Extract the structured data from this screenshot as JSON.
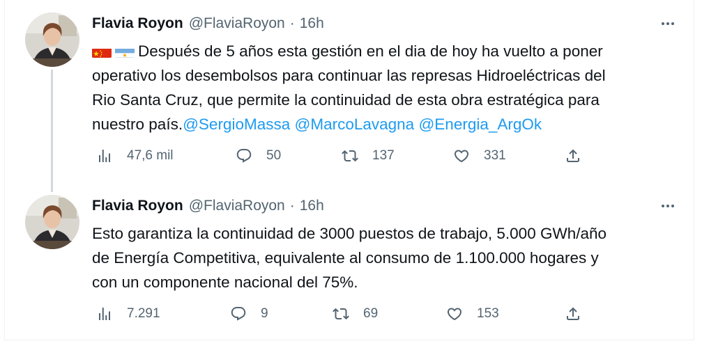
{
  "tweets": [
    {
      "name": "Flavia Royon",
      "handle": "@FlaviaRoyon",
      "separator": "·",
      "time": "16h",
      "flags": [
        "china-flag",
        "argentina-flag"
      ],
      "text_lines": [
        "Después de 5 años esta gestión en el dia de hoy ha vuelto a poner",
        "operativo los desembolsos para continuar las represas Hidroeléctricas del",
        "Rio Santa Cruz, que permite la continuidad de esta obra estratégica para",
        "nuestro país."
      ],
      "mentions": [
        "@SergioMassa",
        "@MarcoLavagna",
        "@Energia_ArgOk"
      ],
      "views": "47,6 mil",
      "replies": "50",
      "retweets": "137",
      "likes": "331"
    },
    {
      "name": "Flavia Royon",
      "handle": "@FlaviaRoyon",
      "separator": "·",
      "time": "16h",
      "text_lines": [
        "Esto garantiza la continuidad de 3000 puestos de trabajo, 5.000 GWh/año",
        "de Energía Competitiva, equivalente al consumo de 1.100.000 hogares y",
        "con un componente nacional del 75%."
      ],
      "views": "7.291",
      "replies": "9",
      "retweets": "69",
      "likes": "153"
    }
  ],
  "colors": {
    "text": "#0f1419",
    "secondary": "#536471",
    "link": "#1d9bf0",
    "thread_line": "#cfd9de",
    "border": "#eff3f4"
  },
  "icons": [
    "more-icon",
    "views-icon",
    "reply-icon",
    "retweet-icon",
    "like-icon",
    "share-icon"
  ]
}
